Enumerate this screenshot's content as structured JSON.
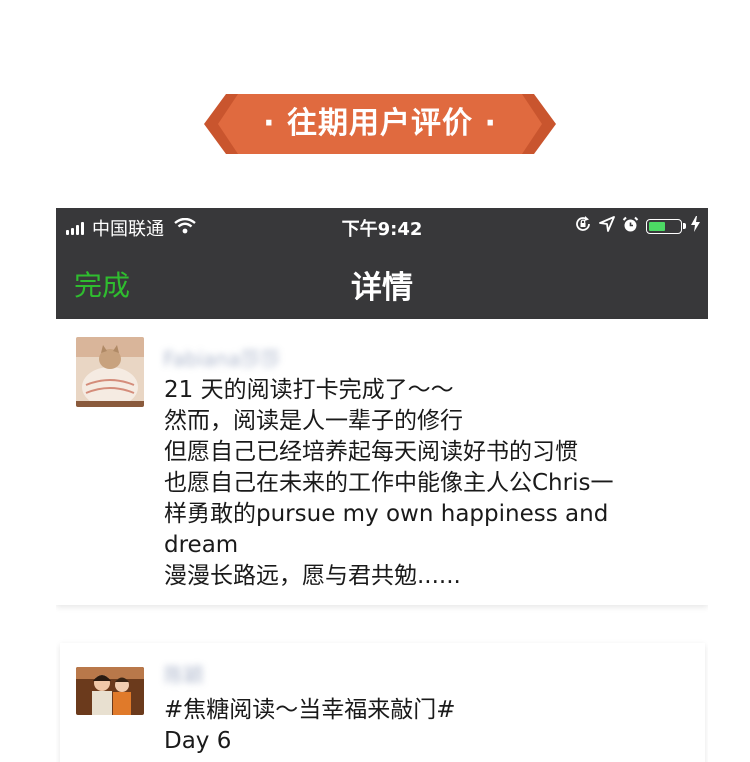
{
  "banner": {
    "title": "· 往期用户评价 ·",
    "color": "#e06a3f",
    "color_dark": "#c9552e"
  },
  "status_bar": {
    "carrier": "中国联通",
    "time": "下午9:42",
    "battery_level": 0.6,
    "icons": [
      "signal-icon",
      "wifi-icon",
      "orientation-lock-icon",
      "location-icon",
      "alarm-icon",
      "battery-icon",
      "charging-icon"
    ]
  },
  "nav": {
    "done_label": "完成",
    "title": "详情",
    "done_color": "#2fbd2f"
  },
  "posts": [
    {
      "name": "Fabiana莎莎",
      "lines": [
        "21 天的阅读打卡完成了～～",
        "然而，阅读是人一辈子的修行",
        "但愿自己已经培养起每天阅读好书的习惯",
        "也愿自己在未来的工作中能像主人公Chris一",
        "样勇敢的pursue my own happiness and",
        "dream",
        "漫漫长路远，愿与君共勉......"
      ]
    },
    {
      "name": "陈颖",
      "lines": [
        "#焦糖阅读～当幸福来敲门#",
        "Day 6"
      ]
    }
  ]
}
